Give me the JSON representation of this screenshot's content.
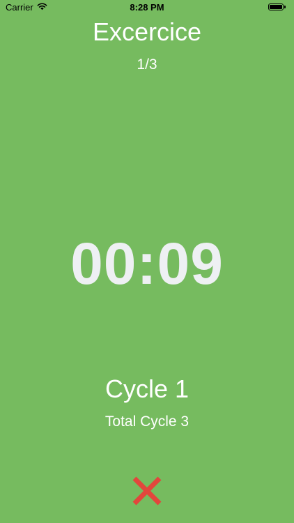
{
  "status_bar": {
    "carrier": "Carrier",
    "time": "8:28 PM",
    "icons": [
      "wifi-icon",
      "battery-icon"
    ]
  },
  "screen": {
    "title": "Excercice",
    "progress": "1/3",
    "timer": "00:09",
    "cycle": "Cycle 1",
    "total_cycle": "Total Cycle 3"
  },
  "actions": {
    "close_icon": "close-icon"
  },
  "colors": {
    "background": "#76bb5f",
    "text": "#ffffff",
    "timer_text": "#eef0f3",
    "close_icon": "#e2463c"
  }
}
